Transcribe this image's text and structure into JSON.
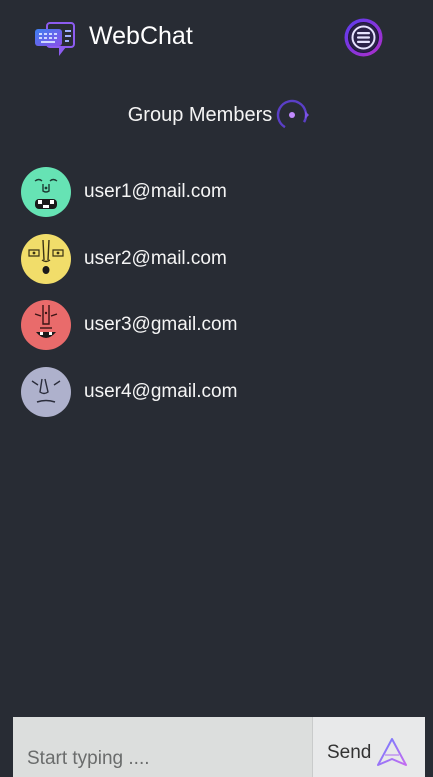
{
  "header": {
    "app_title": "WebChat",
    "logo_icon": "chat-keyboard-icon",
    "menu_icon": "hamburger-menu-icon"
  },
  "members": {
    "heading": "Group Members",
    "heading_icon": "loading-spinner-icon",
    "items": [
      {
        "email": "user1@mail.com",
        "avatar_color": "#66e3b4"
      },
      {
        "email": "user2@mail.com",
        "avatar_color": "#f1dd6a"
      },
      {
        "email": "user3@gmail.com",
        "avatar_color": "#e96b6b"
      },
      {
        "email": "user4@gmail.com",
        "avatar_color": "#aeb1cc"
      }
    ]
  },
  "composer": {
    "placeholder": "Start typing ....",
    "send_label": "Send",
    "send_icon": "paper-plane-icon"
  },
  "colors": {
    "background": "#282c34",
    "accent_purple": "#7b3ff2",
    "accent_blue": "#4f5bd5"
  }
}
